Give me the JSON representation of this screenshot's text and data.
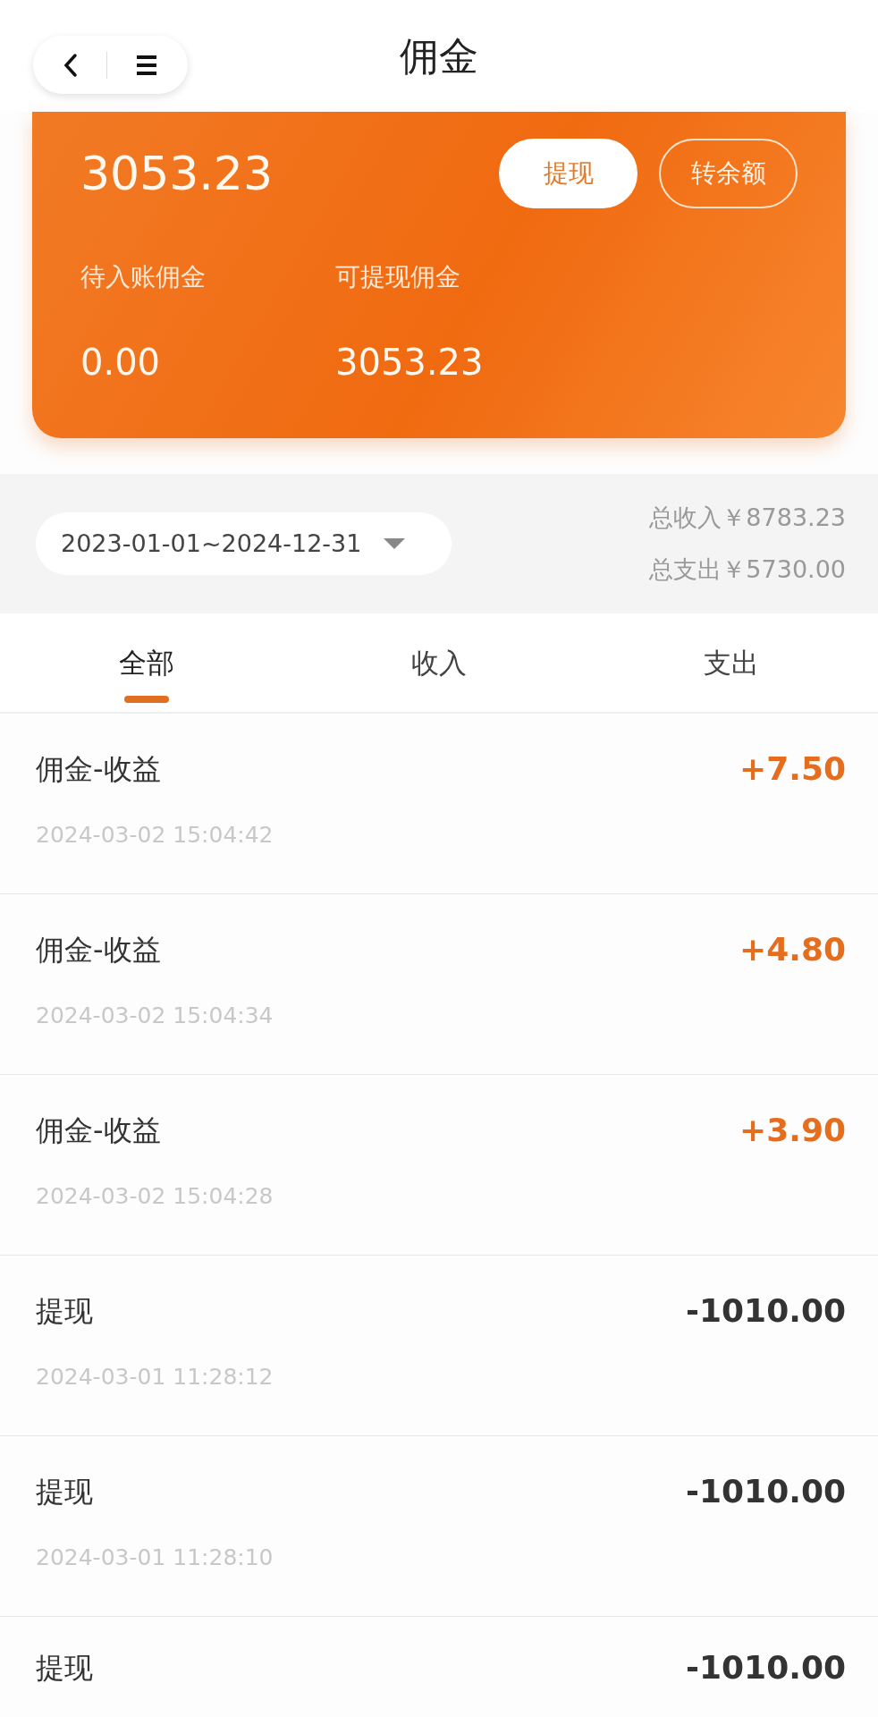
{
  "header": {
    "title": "佣金"
  },
  "balance_card": {
    "amount": "3053.23",
    "buttons": [
      {
        "label": "提现",
        "kind": "solid"
      },
      {
        "label": "转余额",
        "kind": "outline"
      }
    ],
    "stats": [
      {
        "label": "待入账佣金",
        "value": "0.00"
      },
      {
        "label": "可提现佣金",
        "value": "3053.23"
      }
    ]
  },
  "filter": {
    "date_range": "2023-01-01~2024-12-31",
    "totals": [
      "总收入￥8783.23",
      "总支出￥5730.00"
    ]
  },
  "tabs": [
    {
      "label": "全部",
      "selected": true
    },
    {
      "label": "收入",
      "selected": false
    },
    {
      "label": "支出",
      "selected": false
    }
  ],
  "records": [
    {
      "title": "佣金-收益",
      "amount": "+7.50",
      "kind": "income",
      "time": "2024-03-02 15:04:42"
    },
    {
      "title": "佣金-收益",
      "amount": "+4.80",
      "kind": "income",
      "time": "2024-03-02 15:04:34"
    },
    {
      "title": "佣金-收益",
      "amount": "+3.90",
      "kind": "income",
      "time": "2024-03-02 15:04:28"
    },
    {
      "title": "提现",
      "amount": "-1010.00",
      "kind": "expense",
      "time": "2024-03-01 11:28:12"
    },
    {
      "title": "提现",
      "amount": "-1010.00",
      "kind": "expense",
      "time": "2024-03-01 11:28:10"
    },
    {
      "title": "提现",
      "amount": "-1010.00",
      "kind": "expense"
    }
  ]
}
